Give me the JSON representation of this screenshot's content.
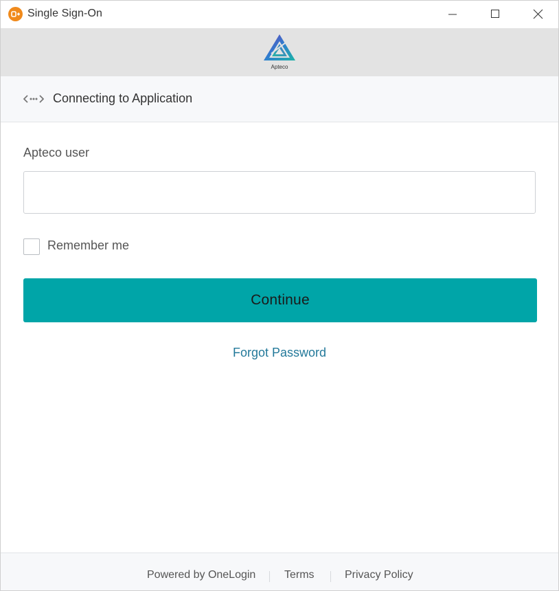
{
  "window": {
    "title": "Single Sign-On",
    "icon": "onelogin-icon",
    "controls": [
      "minimize-icon",
      "maximize-icon",
      "close-icon"
    ]
  },
  "brand": {
    "logo_text": "Apteco",
    "logo_icon": "apteco-logo-icon"
  },
  "header": {
    "icon": "connect-arrows-icon",
    "title": "Connecting to Application"
  },
  "form": {
    "user_label": "Apteco user",
    "user_value": "",
    "remember_label": "Remember me",
    "remember_checked": false,
    "continue_label": "Continue",
    "forgot_label": "Forgot Password"
  },
  "footer": {
    "powered": "Powered by OneLogin",
    "terms": "Terms",
    "privacy": "Privacy Policy"
  },
  "colors": {
    "accent": "#00a5a8",
    "link": "#23799a",
    "app_icon": "#f08a1c",
    "logo_band": "#e3e3e3"
  }
}
